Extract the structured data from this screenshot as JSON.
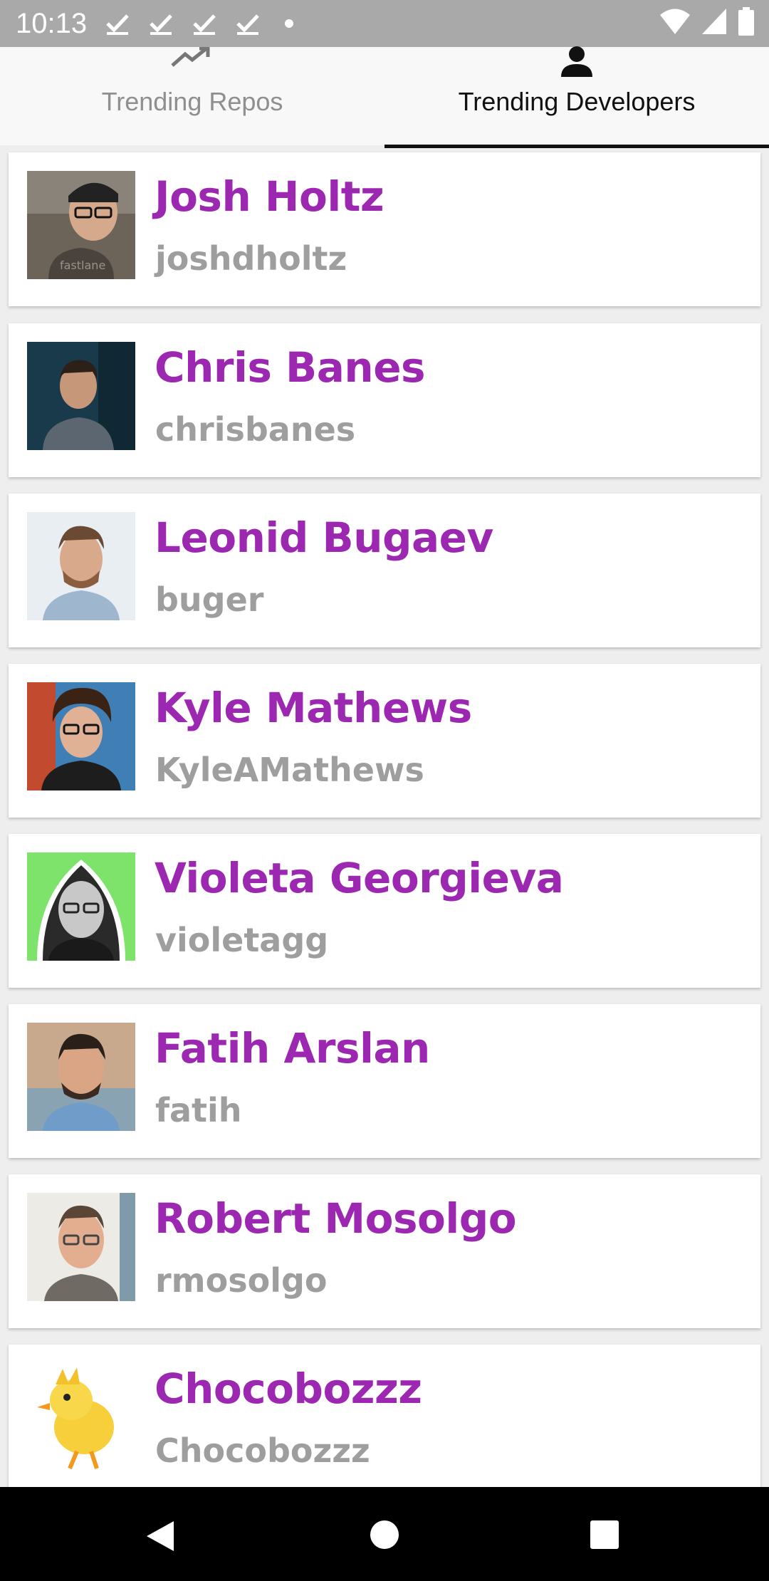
{
  "status": {
    "time": "10:13"
  },
  "tabs": [
    {
      "label": "Trending Repos",
      "icon": "trending-up-icon",
      "active": false
    },
    {
      "label": "Trending Developers",
      "icon": "person-icon",
      "active": true
    }
  ],
  "developers": [
    {
      "name": "Josh Holtz",
      "username": "joshdholtz"
    },
    {
      "name": "Chris Banes",
      "username": "chrisbanes"
    },
    {
      "name": "Leonid Bugaev",
      "username": "buger"
    },
    {
      "name": "Kyle Mathews",
      "username": "KyleAMathews"
    },
    {
      "name": "Violeta Georgieva",
      "username": "violetagg"
    },
    {
      "name": "Fatih Arslan",
      "username": "fatih"
    },
    {
      "name": "Robert Mosolgo",
      "username": "rmosolgo"
    },
    {
      "name": "Chocobozzz",
      "username": "Chocobozzz"
    }
  ],
  "colors": {
    "accent": "#9c27b0",
    "secondary_text": "#9e9e9e",
    "status_bar": "#a9a9a9"
  }
}
